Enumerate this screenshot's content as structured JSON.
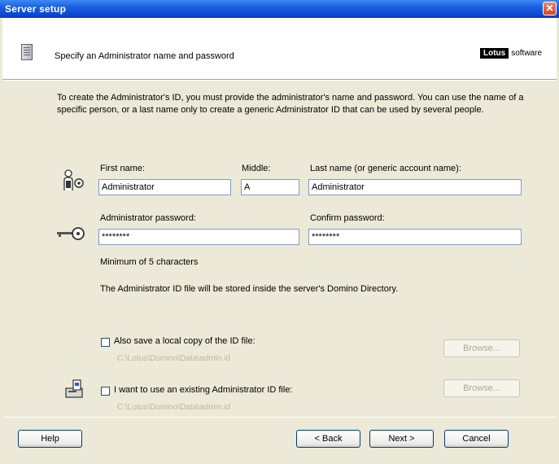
{
  "window": {
    "title": "Server setup",
    "close_glyph": "✕"
  },
  "header": {
    "title": "Specify an Administrator name and password",
    "brand_logo": "Lotus",
    "brand_suffix": "software"
  },
  "description": "To create the Administrator's ID, you must provide the administrator's name and password. You can use the name of a specific person, or a last name only to create a generic Administrator ID that can be used by several people.",
  "form": {
    "first_name": {
      "label": "First name:",
      "value": "Administrator"
    },
    "middle": {
      "label": "Middle:",
      "value": "A"
    },
    "last_name": {
      "label": "Last name (or generic account name):",
      "value": "Administrator"
    },
    "admin_password": {
      "label": "Administrator password:",
      "value": "********"
    },
    "confirm_password": {
      "label": "Confirm password:",
      "value": "********"
    },
    "min_note": "Minimum of 5 characters",
    "store_note": "The Administrator ID file will be stored inside the server's Domino Directory."
  },
  "options": {
    "save_local": {
      "label": "Also save a local copy of the ID file:",
      "path": "C:\\Lotus\\Domino\\Data\\admin.id",
      "checked": false,
      "browse": "Browse..."
    },
    "use_existing": {
      "label": "I want to use an existing Administrator ID file:",
      "path": "C:\\Lotus\\Domino\\Data\\admin.id",
      "checked": false,
      "browse": "Browse..."
    }
  },
  "buttons": {
    "help": "Help",
    "back": "< Back",
    "next": "Next >",
    "cancel": "Cancel"
  },
  "icons": {
    "person": "person-id-icon",
    "key": "key-icon",
    "id_file": "id-file-icon",
    "document": "document-icon"
  }
}
